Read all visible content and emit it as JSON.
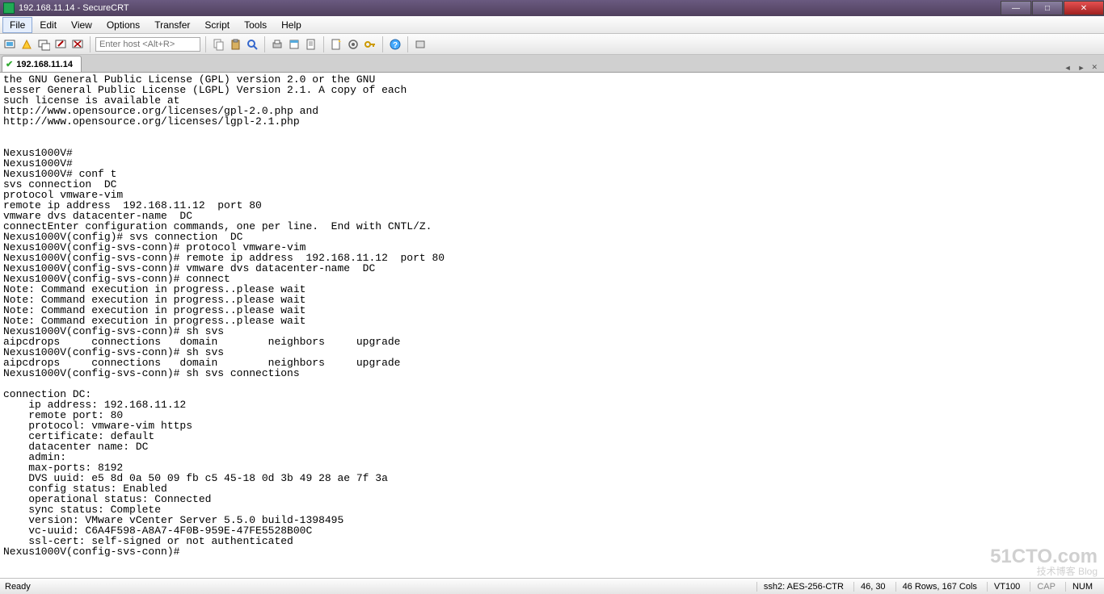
{
  "title": "192.168.11.14 - SecureCRT",
  "menu": [
    "File",
    "Edit",
    "View",
    "Options",
    "Transfer",
    "Script",
    "Tools",
    "Help"
  ],
  "host_placeholder": "Enter host <Alt+R>",
  "tab_label": "192.168.11.14",
  "terminal": "the GNU General Public License (GPL) version 2.0 or the GNU\nLesser General Public License (LGPL) Version 2.1. A copy of each\nsuch license is available at\nhttp://www.opensource.org/licenses/gpl-2.0.php and\nhttp://www.opensource.org/licenses/lgpl-2.1.php\n\n\nNexus1000V#\nNexus1000V#\nNexus1000V# conf t\nsvs connection  DC\nprotocol vmware-vim\nremote ip address  192.168.11.12  port 80\nvmware dvs datacenter-name  DC\nconnectEnter configuration commands, one per line.  End with CNTL/Z.\nNexus1000V(config)# svs connection  DC\nNexus1000V(config-svs-conn)# protocol vmware-vim\nNexus1000V(config-svs-conn)# remote ip address  192.168.11.12  port 80\nNexus1000V(config-svs-conn)# vmware dvs datacenter-name  DC\nNexus1000V(config-svs-conn)# connect\nNote: Command execution in progress..please wait\nNote: Command execution in progress..please wait\nNote: Command execution in progress..please wait\nNote: Command execution in progress..please wait\nNexus1000V(config-svs-conn)# sh svs\naipcdrops     connections   domain        neighbors     upgrade\nNexus1000V(config-svs-conn)# sh svs\naipcdrops     connections   domain        neighbors     upgrade\nNexus1000V(config-svs-conn)# sh svs connections\n\nconnection DC:\n    ip address: 192.168.11.12\n    remote port: 80\n    protocol: vmware-vim https\n    certificate: default\n    datacenter name: DC\n    admin:\n    max-ports: 8192\n    DVS uuid: e5 8d 0a 50 09 fb c5 45-18 0d 3b 49 28 ae 7f 3a\n    config status: Enabled\n    operational status: Connected\n    sync status: Complete\n    version: VMware vCenter Server 5.5.0 build-1398495\n    vc-uuid: C6A4F598-A8A7-4F0B-959E-47FE5528B00C\n    ssl-cert: self-signed or not authenticated\nNexus1000V(config-svs-conn)#",
  "status": {
    "left": "Ready",
    "ssh": "ssh2: AES-256-CTR",
    "pos": "46,  30",
    "size": "46 Rows, 167 Cols",
    "term": "VT100",
    "cap": "CAP",
    "num": "NUM"
  },
  "watermark": {
    "main": "51CTO.com",
    "sub": "技术博客     Blog"
  }
}
